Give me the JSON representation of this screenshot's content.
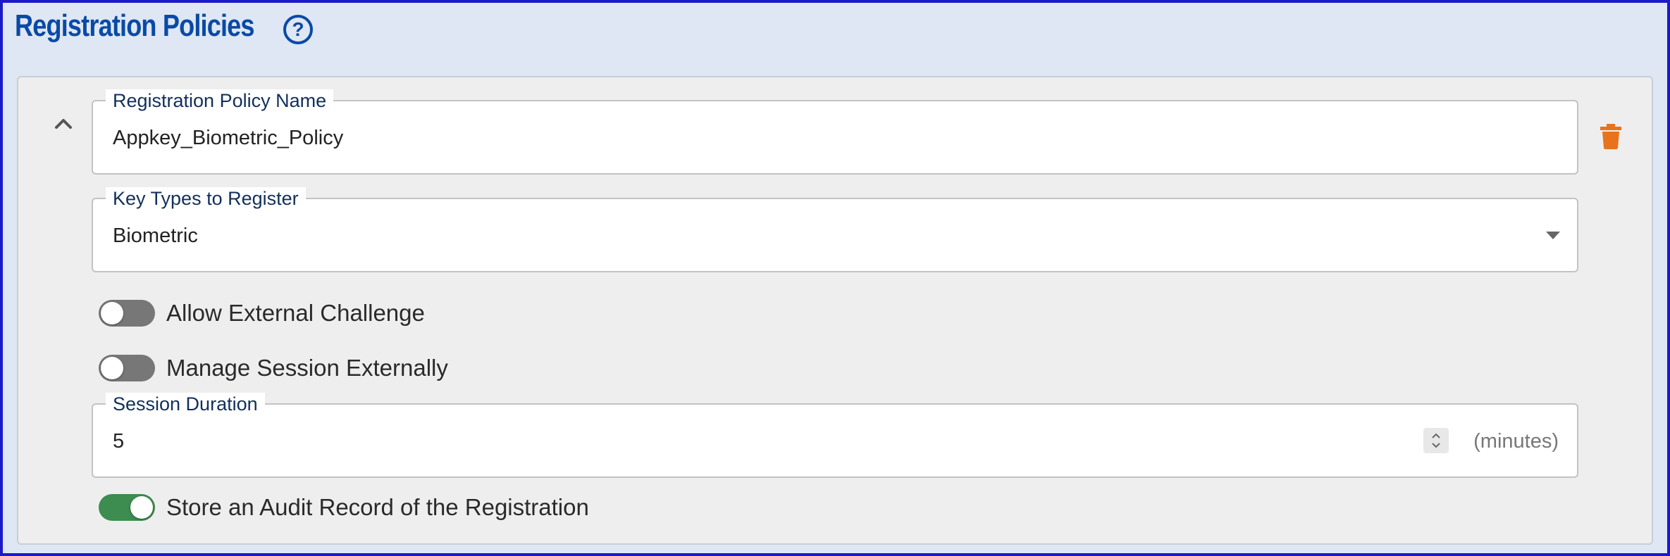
{
  "header": {
    "title": "Registration Policies",
    "help_icon": "help-circle-icon"
  },
  "policy": {
    "collapse_icon": "chevron-up-icon",
    "delete_icon": "trash-icon",
    "delete_color": "#e8731c",
    "name_field": {
      "label": "Registration Policy Name",
      "value": "Appkey_Biometric_Policy"
    },
    "key_types_field": {
      "label": "Key Types to Register",
      "value": "Biometric"
    },
    "toggles": {
      "allow_external_challenge": {
        "label": "Allow External Challenge",
        "on": false
      },
      "manage_session_externally": {
        "label": "Manage Session Externally",
        "on": false
      },
      "store_audit_record": {
        "label": "Store an Audit Record of the Registration",
        "on": true
      }
    },
    "session_duration_field": {
      "label": "Session Duration",
      "value": "5",
      "unit": "(minutes)"
    }
  },
  "colors": {
    "title": "#0a4aa6",
    "frame_border": "#1a1ac8",
    "background": "#dee7f3",
    "card": "#eeeeee",
    "toggle_off": "#777777",
    "toggle_on": "#3d8c50"
  }
}
